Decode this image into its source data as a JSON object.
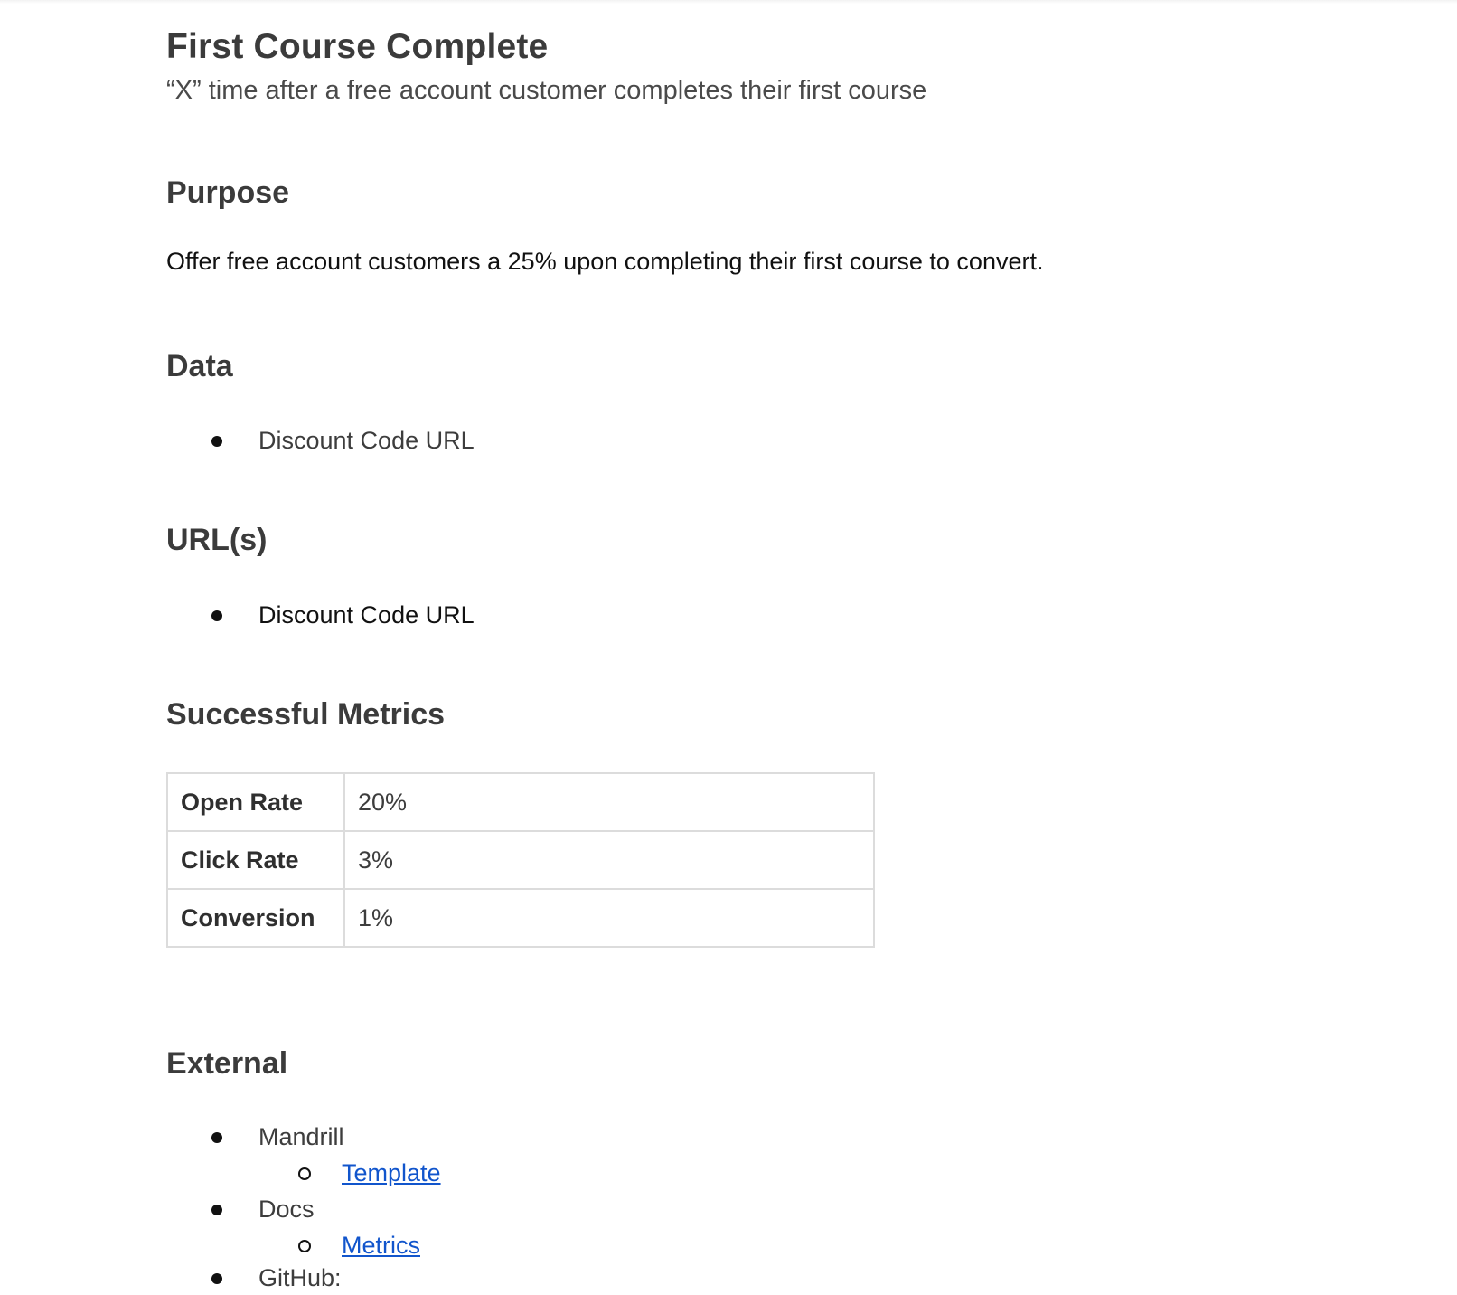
{
  "doc": {
    "title": "First Course Complete",
    "subtitle": "“X” time after a free account customer completes their first course"
  },
  "purpose": {
    "heading": "Purpose",
    "text": "Offer free account customers a 25% upon completing their first course to convert."
  },
  "data_section": {
    "heading": "Data",
    "items": [
      "Discount Code URL"
    ]
  },
  "urls_section": {
    "heading": "URL(s)",
    "items": [
      "Discount Code URL"
    ]
  },
  "metrics": {
    "heading": "Successful Metrics",
    "rows": [
      {
        "label": "Open Rate",
        "value": "20%"
      },
      {
        "label": "Click Rate",
        "value": "3%"
      },
      {
        "label": "Conversion",
        "value": "1%"
      }
    ]
  },
  "external": {
    "heading": "External",
    "items": [
      {
        "label": "Mandrill",
        "link": "Template"
      },
      {
        "label": "Docs",
        "link": "Metrics"
      },
      {
        "label": "GitHub:"
      }
    ]
  },
  "colors": {
    "link": "#1155cc",
    "text": "#3d3d3d",
    "table_border": "#dcdcdc"
  }
}
